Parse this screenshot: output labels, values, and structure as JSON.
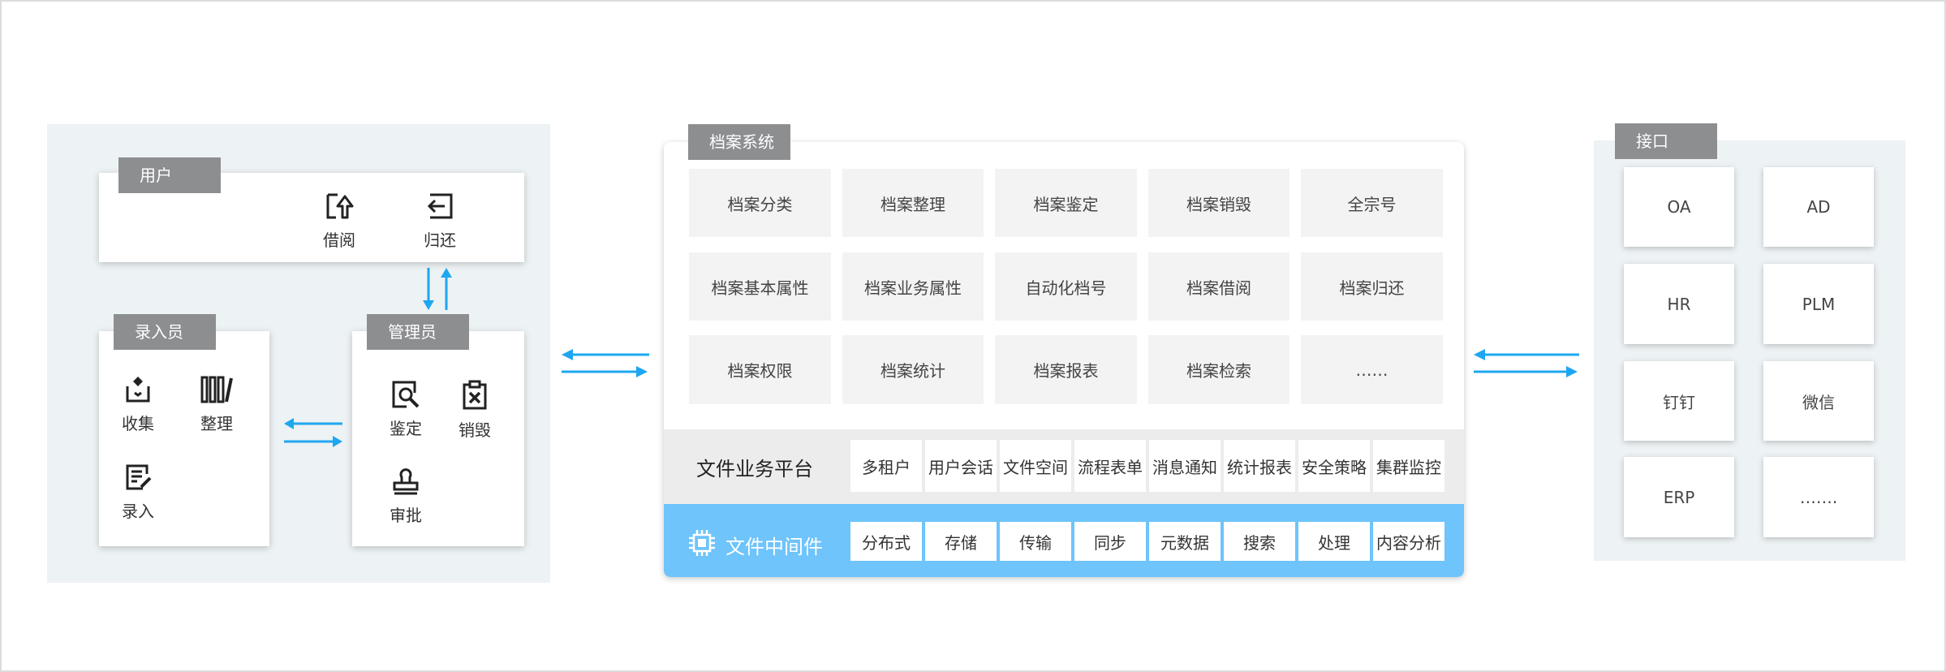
{
  "user_panel": {
    "user": {
      "title": "用户",
      "tools": [
        {
          "label": "借阅",
          "icon": "borrow-icon"
        },
        {
          "label": "归还",
          "icon": "return-icon"
        }
      ]
    },
    "entry": {
      "title": "录入员",
      "tools": [
        {
          "label": "收集",
          "icon": "collect-icon"
        },
        {
          "label": "整理",
          "icon": "organize-icon"
        },
        {
          "label": "录入",
          "icon": "entry-icon"
        }
      ]
    },
    "admin": {
      "title": "管理员",
      "tools": [
        {
          "label": "鉴定",
          "icon": "appraise-icon"
        },
        {
          "label": "销毁",
          "icon": "destroy-icon"
        },
        {
          "label": "审批",
          "icon": "approve-icon"
        }
      ]
    }
  },
  "archive_system": {
    "title": "档案系统",
    "grid": [
      [
        "档案分类",
        "档案整理",
        "档案鉴定",
        "档案销毁",
        "全宗号"
      ],
      [
        "档案基本属性",
        "档案业务属性",
        "自动化档号",
        "档案借阅",
        "档案归还"
      ],
      [
        "档案权限",
        "档案统计",
        "档案报表",
        "档案检索",
        "……"
      ]
    ],
    "platform": {
      "title": "文件业务平台",
      "items": [
        "多租户",
        "用户会话",
        "文件空间",
        "流程表单",
        "消息通知",
        "统计报表",
        "安全策略",
        "集群监控"
      ]
    },
    "middleware": {
      "title": "文件中间件",
      "icon": "chip-icon",
      "items": [
        "分布式",
        "存储",
        "传输",
        "同步",
        "元数据",
        "搜索",
        "处理",
        "内容分析"
      ]
    }
  },
  "interface": {
    "title": "接口",
    "items": [
      "OA",
      "AD",
      "HR",
      "PLM",
      "钉钉",
      "微信",
      "ERP",
      "……."
    ]
  },
  "colors": {
    "arrow": "#1ea7f0",
    "tag": "#8d8e90",
    "panel": "#edf2f4",
    "middleware": "#6ec4fb"
  }
}
